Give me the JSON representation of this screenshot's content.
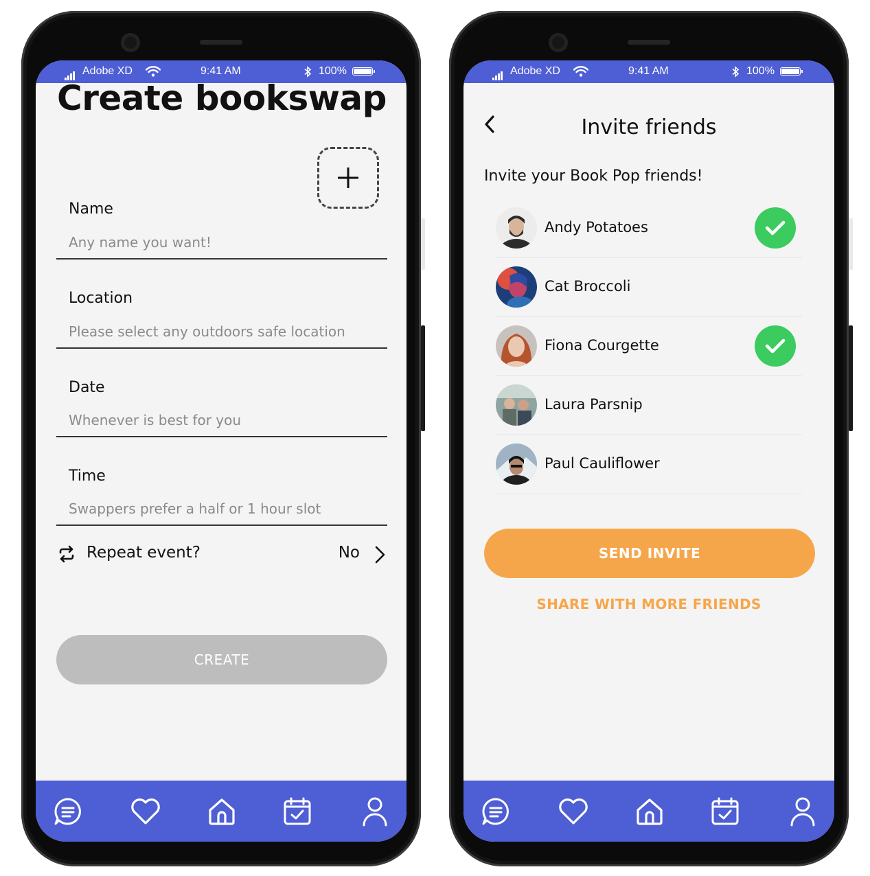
{
  "status_bar": {
    "carrier": "Adobe XD",
    "time": "9:41 AM",
    "battery": "100%"
  },
  "create_screen": {
    "title": "Create bookswap",
    "fields": [
      {
        "label": "Name",
        "placeholder": "Any name you want!"
      },
      {
        "label": "Location",
        "placeholder": "Please select any outdoors safe location"
      },
      {
        "label": "Date",
        "placeholder": "Whenever is best for you"
      },
      {
        "label": "Time",
        "placeholder": "Swappers prefer a half or 1 hour slot"
      }
    ],
    "repeat": {
      "label": "Repeat event?",
      "value": "No"
    },
    "create_button": "CREATE"
  },
  "invite_screen": {
    "title": "Invite friends",
    "subtitle": "Invite your Book Pop friends!",
    "friends": [
      {
        "name": "Andy Potatoes",
        "selected": true
      },
      {
        "name": "Cat Broccoli",
        "selected": false
      },
      {
        "name": "Fiona Courgette",
        "selected": true
      },
      {
        "name": "Laura Parsnip",
        "selected": false
      },
      {
        "name": "Paul Cauliflower",
        "selected": false
      }
    ],
    "send_button": "SEND INVITE",
    "share_link": "SHARE WITH MORE FRIENDS"
  },
  "tab_bar": {
    "icons": [
      "chat-icon",
      "heart-icon",
      "home-icon",
      "calendar-icon",
      "profile-icon"
    ]
  },
  "colors": {
    "brand": "#4e5ed4",
    "accent": "#f6a64a",
    "check": "#3ccb5f",
    "disabled": "#bdbdbd"
  }
}
